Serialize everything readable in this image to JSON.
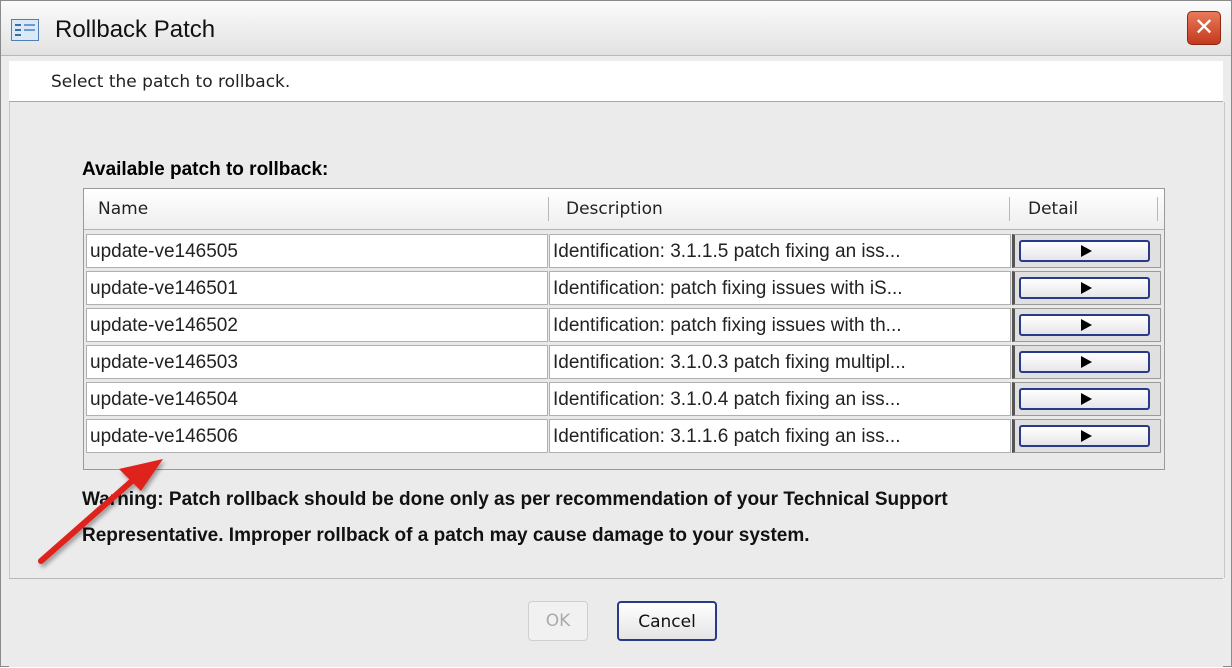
{
  "window": {
    "title": "Rollback Patch",
    "close_glyph": "✕"
  },
  "instruction": "Select the patch to rollback.",
  "section_label": "Available patch to rollback:",
  "table": {
    "columns": [
      "Name",
      "Description",
      "Detail"
    ],
    "rows": [
      {
        "name": "update-ve146505",
        "description": "Identification: 3.1.1.5 patch fixing an iss..."
      },
      {
        "name": "update-ve146501",
        "description": "Identification: patch fixing issues with iS..."
      },
      {
        "name": "update-ve146502",
        "description": "Identification: patch fixing issues with th..."
      },
      {
        "name": "update-ve146503",
        "description": "Identification: 3.1.0.3 patch fixing multipl..."
      },
      {
        "name": "update-ve146504",
        "description": "Identification: 3.1.0.4 patch fixing an iss..."
      },
      {
        "name": "update-ve146506",
        "description": "Identification: 3.1.1.6 patch fixing an iss..."
      }
    ],
    "detail_icon": "play-arrow-icon"
  },
  "warning": {
    "line1": "Warning: Patch rollback should be done only as per recommendation of your Technical Support",
    "line2": "Representative. Improper rollback of a patch may cause damage to your system."
  },
  "buttons": {
    "ok_label": "OK",
    "cancel_label": "Cancel"
  },
  "colors": {
    "annotation_arrow": "#e0201b",
    "focus_border": "#2a3a8a"
  }
}
